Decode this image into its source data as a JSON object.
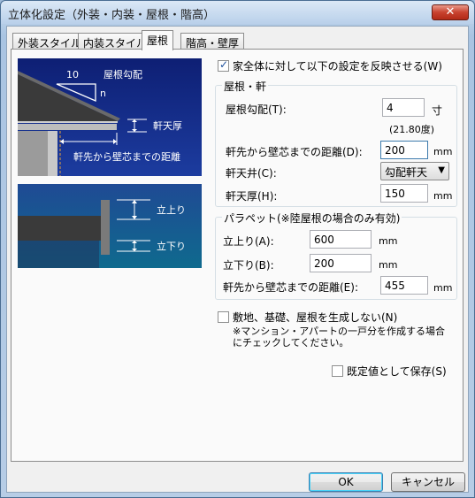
{
  "window": {
    "title": "立体化設定（外装・内装・屋根・階高）",
    "close_label": "✕"
  },
  "tabs": [
    {
      "label": "外装スタイル"
    },
    {
      "label": "内装スタイル"
    },
    {
      "label": "屋根"
    },
    {
      "label": "階高・壁厚"
    }
  ],
  "diagram1": {
    "ten": "10",
    "roof_pitch": "屋根勾配",
    "n": "n",
    "soffit": "軒天厚",
    "eave_dist": "軒先から壁芯までの距離"
  },
  "diagram2": {
    "rise": "立上り",
    "drop": "立下り"
  },
  "apply_all": {
    "label": "家全体に対して以下の設定を反映させる(W)",
    "checked": true
  },
  "roof_group": {
    "title": "屋根・軒",
    "pitch_label": "屋根勾配(T):",
    "pitch_value": "4",
    "pitch_unit": "寸",
    "pitch_degrees": "(21.80度)",
    "eave_label": "軒先から壁芯までの距離(D):",
    "eave_value": "200",
    "eave_unit": "mm",
    "soffit_label": "軒天井(C):",
    "soffit_value": "勾配軒天",
    "soffit_thick_label": "軒天厚(H):",
    "soffit_thick_value": "150",
    "soffit_thick_unit": "mm"
  },
  "parapet_group": {
    "title": "パラペット(※陸屋根の場合のみ有効)",
    "rise_label": "立上り(A):",
    "rise_value": "600",
    "rise_unit": "mm",
    "drop_label": "立下り(B):",
    "drop_value": "200",
    "drop_unit": "mm",
    "eave_label": "軒先から壁芯までの距離(E):",
    "eave_value": "455",
    "eave_unit": "mm"
  },
  "no_foundation": {
    "label": "敷地、基礎、屋根を生成しない(N)",
    "checked": false,
    "note_line1": "※マンション・アパートの一戸分を作成する場合",
    "note_line2": "にチェックしてください。"
  },
  "save_default": {
    "label": "既定値として保存(S)",
    "checked": false
  },
  "buttons": {
    "ok": "OK",
    "cancel": "キャンセル"
  }
}
